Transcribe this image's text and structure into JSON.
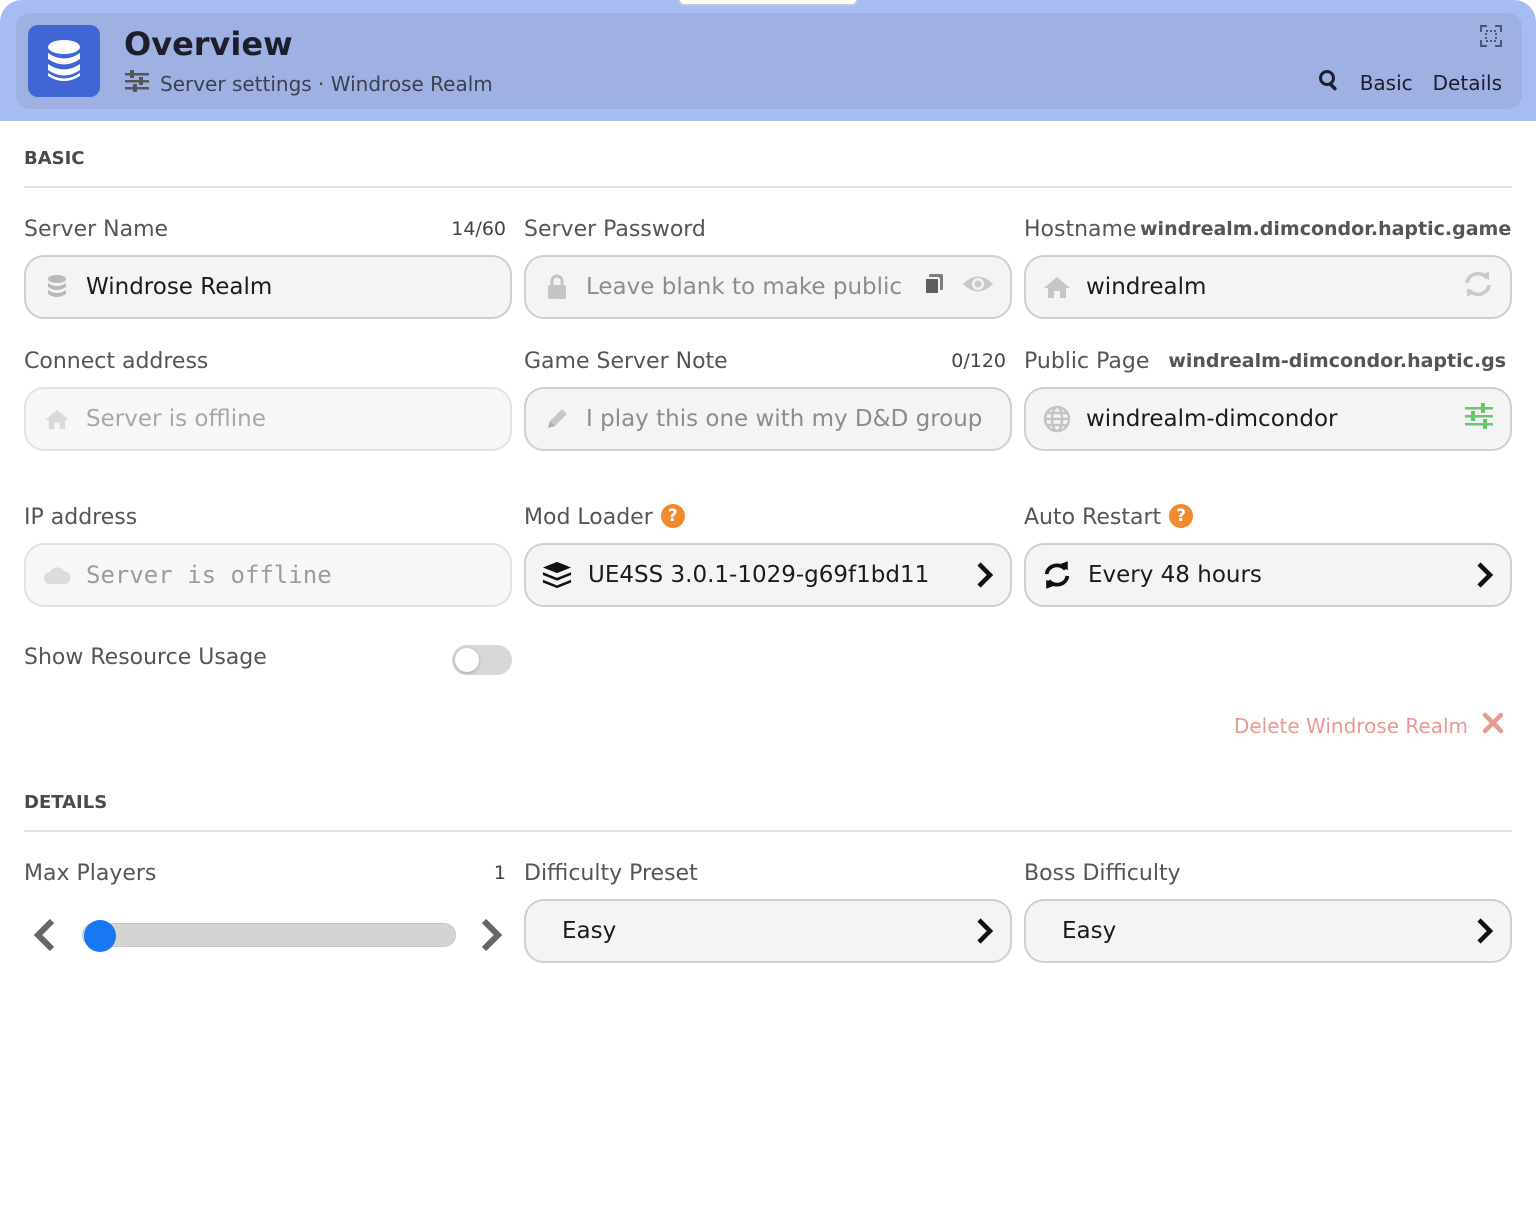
{
  "header": {
    "title": "Overview",
    "subtitle": "Server settings · Windrose Realm",
    "nav": [
      "Basic",
      "Details"
    ],
    "accent": "#3f66d2"
  },
  "basic": {
    "section_title": "BASIC",
    "server_name": {
      "label": "Server Name",
      "counter": "14/60",
      "value": "Windrose Realm"
    },
    "server_password": {
      "label": "Server Password",
      "placeholder": "Leave blank to make public"
    },
    "hostname": {
      "label": "Hostname",
      "domain": "windrealm.dimcondor.haptic.game",
      "value": "windrealm"
    },
    "connect_address": {
      "label": "Connect address",
      "placeholder": "Server is offline"
    },
    "game_server_note": {
      "label": "Game Server Note",
      "counter": "0/120",
      "placeholder": "I play this one with my D&D group"
    },
    "public_page": {
      "label": "Public Page",
      "domain": "windrealm-dimcondor.haptic.gs",
      "value": "windrealm-dimcondor"
    },
    "ip_address": {
      "label": "IP address",
      "placeholder": "Server is offline"
    },
    "mod_loader": {
      "label": "Mod Loader",
      "value": "UE4SS 3.0.1-1029-g69f1bd11"
    },
    "auto_restart": {
      "label": "Auto Restart",
      "value": "Every 48 hours"
    },
    "show_resource_usage": {
      "label": "Show Resource Usage",
      "enabled": false
    },
    "delete_label": "Delete Windrose Realm",
    "delete_color": "#e79a92"
  },
  "details": {
    "section_title": "DETAILS",
    "max_players": {
      "label": "Max Players",
      "value": "1"
    },
    "difficulty_preset": {
      "label": "Difficulty Preset",
      "value": "Easy"
    },
    "boss_difficulty": {
      "label": "Boss Difficulty",
      "value": "Easy"
    },
    "slider_color": "#1877f2"
  }
}
